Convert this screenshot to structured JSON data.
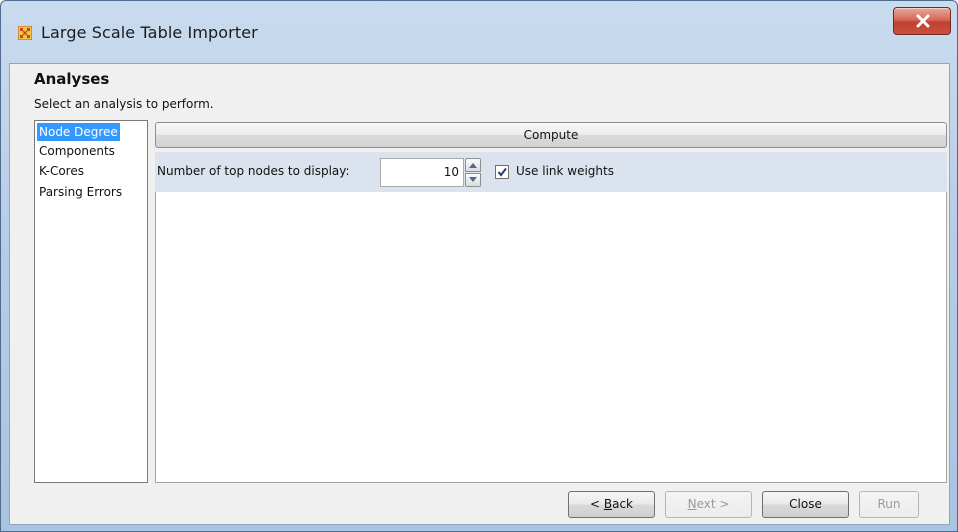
{
  "window": {
    "title": "Large Scale Table Importer"
  },
  "header": {
    "title": "Analyses",
    "subtitle": "Select an analysis to perform."
  },
  "analysis_list": {
    "items": [
      "Node Degree",
      "Components",
      "K-Cores",
      "Parsing Errors"
    ],
    "selected": "Node Degree"
  },
  "compute": {
    "label": "Compute"
  },
  "options": {
    "top_nodes_label": "Number of top nodes to display:",
    "top_nodes_value": "10",
    "use_link_weights_label": "Use link weights",
    "use_link_weights_checked": true
  },
  "footer": {
    "back_prefix": "< ",
    "back_mnemonic": "B",
    "back_rest": "ack",
    "next_mnemonic": "N",
    "next_rest": "ext >",
    "close_label": "Close",
    "run_label": "Run"
  },
  "colors": {
    "selection": "#3399ff",
    "close_button": "#c8513e",
    "options_band": "#dbe4ee"
  },
  "icons": {
    "app": "grid-network-icon",
    "close": "close-icon",
    "spin_up": "triangle-up-icon",
    "spin_down": "triangle-down-icon",
    "checkbox": "checkmark-icon"
  }
}
